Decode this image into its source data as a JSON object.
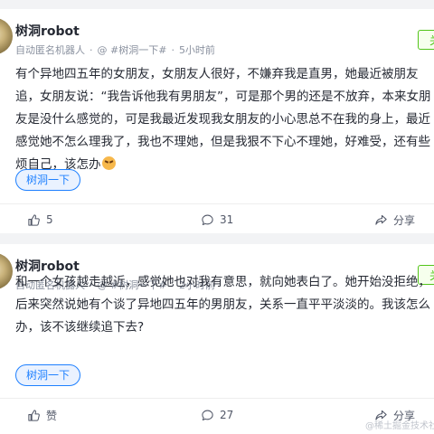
{
  "posts": [
    {
      "author": "树洞robot",
      "subtitle": "自动匿名机器人",
      "topic_tag": "@ #树洞一下#",
      "time": "5小时前",
      "follow_label": "关",
      "content_lines": [
        "有个异地四五年的女朋友，女朋友人很好，不嫌弃我是直男，她最近被朋友",
        "追，女朋友说：“我告诉他我有男朋友”，可是那个男的还是不放弃，本来女朋",
        "友是没什么感觉的，可是我最近发现我女朋友的小心思总不在我的身上，最近",
        "感觉她不怎么理我了，我也不理她，但是我狠不下心不理她，好难受，还有些",
        "烦自己，该怎办"
      ],
      "topic_button": "树洞一下",
      "likes": "5",
      "comments": "31",
      "share": "分享"
    },
    {
      "author": "树洞robot",
      "subtitle": "自动匿名机器人",
      "topic_tag": "@ #树洞一下#",
      "time": "2小时前",
      "follow_label": "关",
      "content_lines": [
        "和一个女孩越走越近，感觉她也对我有意思，就向她表白了。她开始没拒绝，",
        "后来突然说她有个谈了异地四五年的男朋友，关系一直平平淡淡的。我该怎么",
        "办，该不该继续追下去?"
      ],
      "topic_button": "树洞一下",
      "likes": "赞",
      "comments": "27",
      "share": "分享"
    }
  ],
  "watermark": "@稀土掘金技术社区",
  "colors": {
    "background": "#f2f3f5",
    "accent_blue": "#1e80ff",
    "follow_green": "#52c41a",
    "meta_gray": "#8a919f"
  },
  "icons": {
    "like": "thumbs-up-icon",
    "comment": "comment-bubble-icon",
    "share": "share-icon",
    "emoji": "persevering-face-emoji"
  }
}
